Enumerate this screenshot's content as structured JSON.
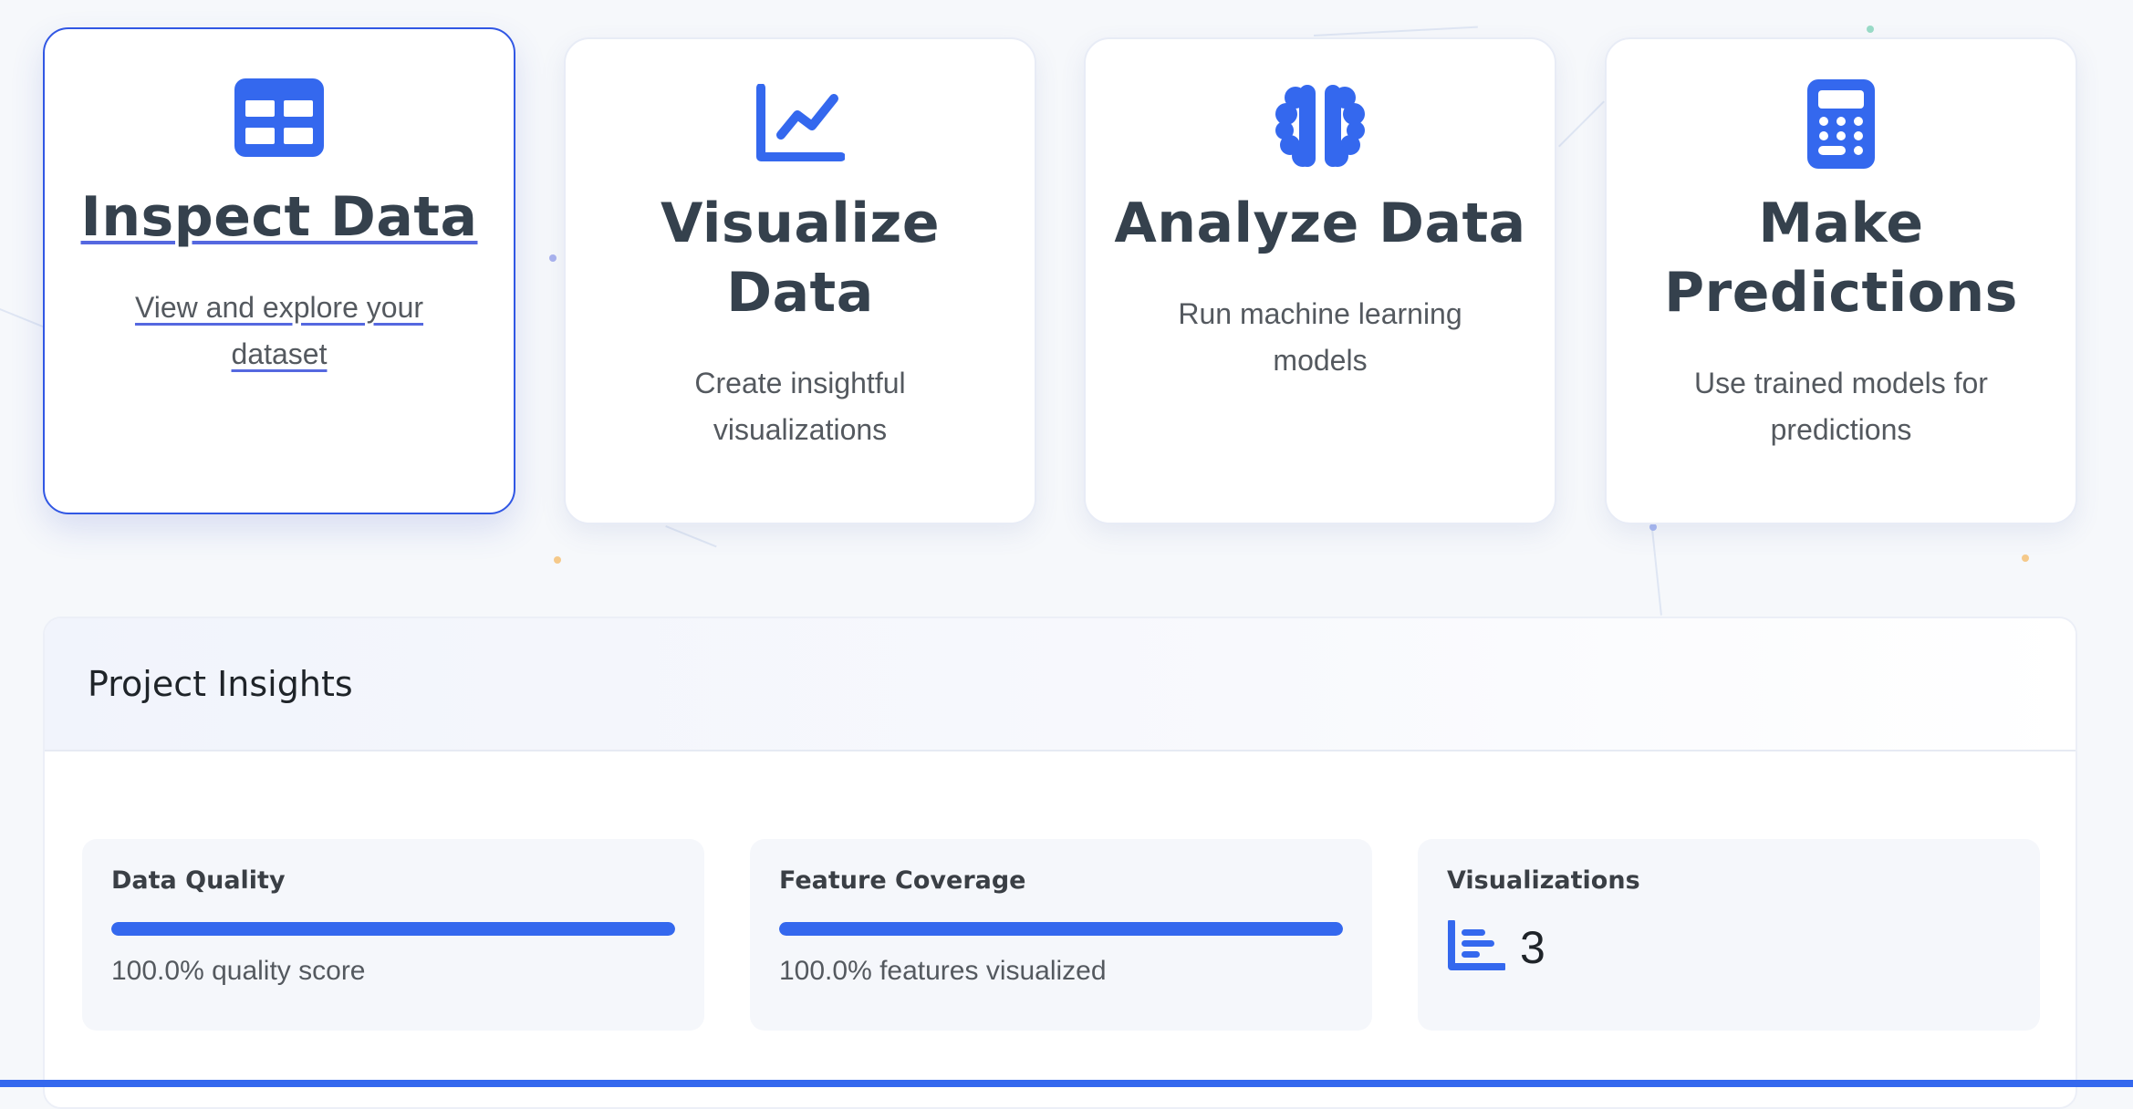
{
  "accent_color": "#3468ee",
  "cards": [
    {
      "title": "Inspect Data",
      "description": "View and explore your dataset",
      "icon": "table-icon",
      "active": true
    },
    {
      "title": "Visualize Data",
      "description": "Create insightful visualizations",
      "icon": "line-chart-icon",
      "active": false
    },
    {
      "title": "Analyze Data",
      "description": "Run machine learning models",
      "icon": "brain-icon",
      "active": false
    },
    {
      "title": "Make Predictions",
      "description": "Use trained models for predictions",
      "icon": "calculator-icon",
      "active": false
    }
  ],
  "insights": {
    "title": "Project Insights",
    "metrics": [
      {
        "label": "Data Quality",
        "value_fraction": 1.0,
        "text": "100.0% quality score"
      },
      {
        "label": "Feature Coverage",
        "value_fraction": 1.0,
        "text": "100.0% features visualized"
      },
      {
        "label": "Visualizations",
        "icon": "bar-chart-icon",
        "count": "3"
      }
    ]
  }
}
